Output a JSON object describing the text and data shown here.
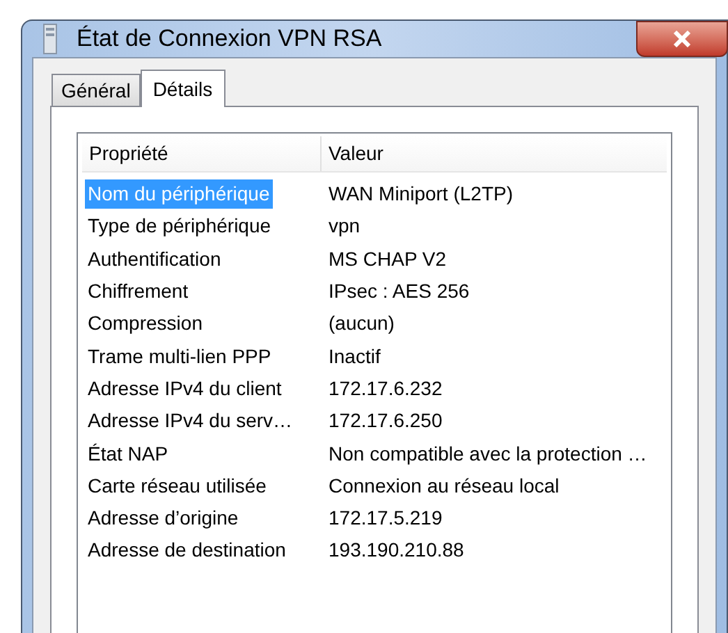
{
  "window": {
    "title": "État de Connexion VPN RSA"
  },
  "tabs": [
    {
      "label": "Général",
      "selected": false
    },
    {
      "label": "Détails",
      "selected": true
    }
  ],
  "table": {
    "columns": [
      "Propriété",
      "Valeur"
    ],
    "rows": [
      {
        "property": "Nom du périphérique",
        "value": "WAN Miniport (L2TP)",
        "selected": true
      },
      {
        "property": "Type de périphérique",
        "value": "vpn",
        "selected": false
      },
      {
        "property": "Authentification",
        "value": "MS CHAP V2",
        "selected": false
      },
      {
        "property": "Chiffrement",
        "value": "IPsec : AES 256",
        "selected": false
      },
      {
        "property": "Compression",
        "value": "(aucun)",
        "selected": false
      },
      {
        "property": "Trame multi-lien PPP",
        "value": "Inactif",
        "selected": false
      },
      {
        "property": "Adresse IPv4 du client",
        "value": "172.17.6.232",
        "selected": false
      },
      {
        "property": "Adresse IPv4 du serv…",
        "value": "172.17.6.250",
        "selected": false
      },
      {
        "property": "État NAP",
        "value": "Non compatible avec la protection …",
        "selected": false
      },
      {
        "property": "Carte réseau utilisée",
        "value": "Connexion au réseau local",
        "selected": false
      },
      {
        "property": "Adresse d’origine",
        "value": "172.17.5.219",
        "selected": false
      },
      {
        "property": "Adresse de destination",
        "value": "193.190.210.88",
        "selected": false
      }
    ]
  }
}
